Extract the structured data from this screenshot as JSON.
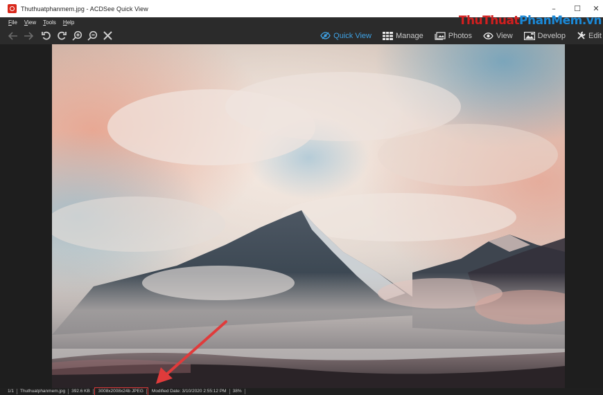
{
  "window": {
    "title": "Thuthuatphanmem.jpg - ACDSee Quick View",
    "controls": {
      "minimize": "–",
      "maximize": "☐",
      "close": "✕"
    }
  },
  "watermark": {
    "part1": "ThuThuat",
    "part2": "PhanMem",
    "suffix": ".vn"
  },
  "menu": {
    "items": [
      {
        "label": "File",
        "ul": "F",
        "rest": "ile"
      },
      {
        "label": "View",
        "ul": "V",
        "rest": "iew"
      },
      {
        "label": "Tools",
        "ul": "T",
        "rest": "ools"
      },
      {
        "label": "Help",
        "ul": "H",
        "rest": "elp"
      }
    ]
  },
  "toolbar": {
    "icons": [
      "back-arrow-icon",
      "forward-arrow-icon",
      "rotate-left-icon",
      "rotate-right-icon",
      "zoom-in-icon",
      "zoom-out-icon",
      "close-icon"
    ]
  },
  "modes": [
    {
      "label": "Quick View",
      "icon": "eye-slash-icon",
      "active": true
    },
    {
      "label": "Manage",
      "icon": "grid-icon",
      "active": false
    },
    {
      "label": "Photos",
      "icon": "photos-icon",
      "active": false
    },
    {
      "label": "View",
      "icon": "eye-icon",
      "active": false
    },
    {
      "label": "Develop",
      "icon": "develop-icon",
      "active": false
    },
    {
      "label": "Edit",
      "icon": "tools-icon",
      "active": false
    }
  ],
  "status": {
    "index": "1/1",
    "filename": "Thuthuatphanmem.jpg",
    "filesize": "392.6 KB",
    "dimensions": "3008x2008x24b JPEG",
    "modified": "Modified Date: 3/10/2020 2:55:12 PM",
    "zoom": "38%"
  },
  "colors": {
    "accent": "#3fa3e6",
    "annotation": "#e03b3b",
    "background": "#1e1e1e",
    "toolbar": "#2b2b2b"
  }
}
